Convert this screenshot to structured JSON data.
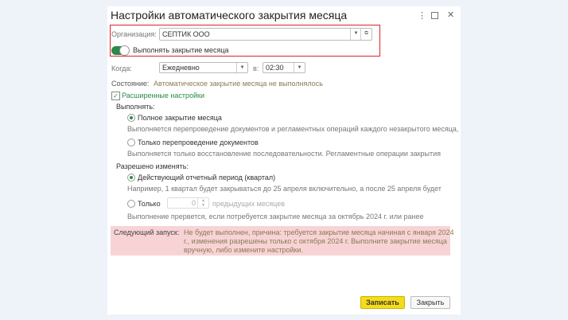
{
  "title": "Настройки автоматического закрытия месяца",
  "org": {
    "label": "Организация:",
    "value": "СЕПТИК ООО"
  },
  "toggle": {
    "label": "Выполнять закрытие месяца",
    "on": true
  },
  "when": {
    "label": "Когда:",
    "value": "Ежедневно",
    "at_label": "в:",
    "time": "02:30"
  },
  "state": {
    "label": "Состояние:",
    "value": "Автоматическое закрытие месяца не выполнялось"
  },
  "advanced": {
    "label": "Расширенные настройки"
  },
  "execute": {
    "label": "Выполнять:",
    "opt1": "Полное закрытие месяца",
    "desc1": "Выполняется перепроведение документов и регламентных операций каждого незакрытого месяца,",
    "opt2": "Только перепроведение документов",
    "desc2": "Выполняется только восстановление последовательности. Регламентные операции закрытия"
  },
  "allowed": {
    "label": "Разрешено изменять:",
    "opt1": "Действующий отчетный период (квартал)",
    "desc1": "Например, 1 квартал будет закрываться до 25 апреля включительно, а после 25 апреля будет",
    "opt2": "Только",
    "count": "0",
    "count_suffix": "предыдущих месяцев",
    "desc2": "Выполнение прервется, если потребуется закрытие месяца за октябрь 2024 г. или ранее"
  },
  "next": {
    "label": "Следующий запуск:",
    "line1": "Не будет выполнен, причина: требуется закрытие месяца начиная с января 2024",
    "line2": "г., изменения разрешены только с октября 2024 г. Выполните закрытие месяца",
    "line3": "вручную, либо измените настройки."
  },
  "buttons": {
    "save": "Записать",
    "close": "Закрыть"
  },
  "colors": {
    "accent": "#2a8a4a",
    "highlight": "#e53935",
    "warning_bg": "#f8d3d5",
    "primary_btn": "#f5dc1a"
  }
}
